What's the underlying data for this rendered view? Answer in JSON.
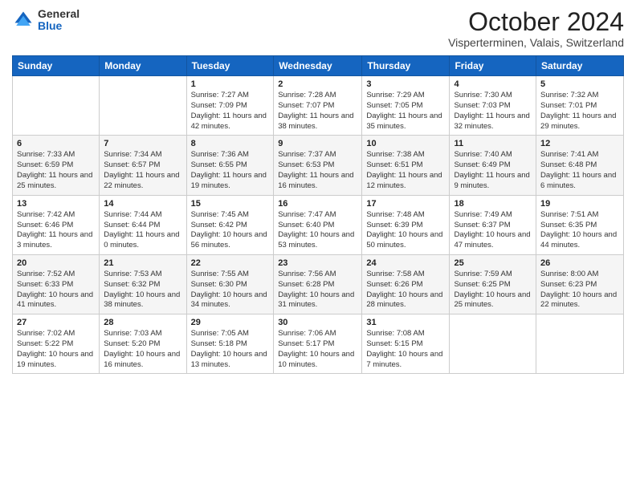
{
  "header": {
    "logo_general": "General",
    "logo_blue": "Blue",
    "month_title": "October 2024",
    "location": "Visperterminen, Valais, Switzerland"
  },
  "weekdays": [
    "Sunday",
    "Monday",
    "Tuesday",
    "Wednesday",
    "Thursday",
    "Friday",
    "Saturday"
  ],
  "weeks": [
    [
      {
        "day": "",
        "detail": ""
      },
      {
        "day": "",
        "detail": ""
      },
      {
        "day": "1",
        "detail": "Sunrise: 7:27 AM\nSunset: 7:09 PM\nDaylight: 11 hours and 42 minutes."
      },
      {
        "day": "2",
        "detail": "Sunrise: 7:28 AM\nSunset: 7:07 PM\nDaylight: 11 hours and 38 minutes."
      },
      {
        "day": "3",
        "detail": "Sunrise: 7:29 AM\nSunset: 7:05 PM\nDaylight: 11 hours and 35 minutes."
      },
      {
        "day": "4",
        "detail": "Sunrise: 7:30 AM\nSunset: 7:03 PM\nDaylight: 11 hours and 32 minutes."
      },
      {
        "day": "5",
        "detail": "Sunrise: 7:32 AM\nSunset: 7:01 PM\nDaylight: 11 hours and 29 minutes."
      }
    ],
    [
      {
        "day": "6",
        "detail": "Sunrise: 7:33 AM\nSunset: 6:59 PM\nDaylight: 11 hours and 25 minutes."
      },
      {
        "day": "7",
        "detail": "Sunrise: 7:34 AM\nSunset: 6:57 PM\nDaylight: 11 hours and 22 minutes."
      },
      {
        "day": "8",
        "detail": "Sunrise: 7:36 AM\nSunset: 6:55 PM\nDaylight: 11 hours and 19 minutes."
      },
      {
        "day": "9",
        "detail": "Sunrise: 7:37 AM\nSunset: 6:53 PM\nDaylight: 11 hours and 16 minutes."
      },
      {
        "day": "10",
        "detail": "Sunrise: 7:38 AM\nSunset: 6:51 PM\nDaylight: 11 hours and 12 minutes."
      },
      {
        "day": "11",
        "detail": "Sunrise: 7:40 AM\nSunset: 6:49 PM\nDaylight: 11 hours and 9 minutes."
      },
      {
        "day": "12",
        "detail": "Sunrise: 7:41 AM\nSunset: 6:48 PM\nDaylight: 11 hours and 6 minutes."
      }
    ],
    [
      {
        "day": "13",
        "detail": "Sunrise: 7:42 AM\nSunset: 6:46 PM\nDaylight: 11 hours and 3 minutes."
      },
      {
        "day": "14",
        "detail": "Sunrise: 7:44 AM\nSunset: 6:44 PM\nDaylight: 11 hours and 0 minutes."
      },
      {
        "day": "15",
        "detail": "Sunrise: 7:45 AM\nSunset: 6:42 PM\nDaylight: 10 hours and 56 minutes."
      },
      {
        "day": "16",
        "detail": "Sunrise: 7:47 AM\nSunset: 6:40 PM\nDaylight: 10 hours and 53 minutes."
      },
      {
        "day": "17",
        "detail": "Sunrise: 7:48 AM\nSunset: 6:39 PM\nDaylight: 10 hours and 50 minutes."
      },
      {
        "day": "18",
        "detail": "Sunrise: 7:49 AM\nSunset: 6:37 PM\nDaylight: 10 hours and 47 minutes."
      },
      {
        "day": "19",
        "detail": "Sunrise: 7:51 AM\nSunset: 6:35 PM\nDaylight: 10 hours and 44 minutes."
      }
    ],
    [
      {
        "day": "20",
        "detail": "Sunrise: 7:52 AM\nSunset: 6:33 PM\nDaylight: 10 hours and 41 minutes."
      },
      {
        "day": "21",
        "detail": "Sunrise: 7:53 AM\nSunset: 6:32 PM\nDaylight: 10 hours and 38 minutes."
      },
      {
        "day": "22",
        "detail": "Sunrise: 7:55 AM\nSunset: 6:30 PM\nDaylight: 10 hours and 34 minutes."
      },
      {
        "day": "23",
        "detail": "Sunrise: 7:56 AM\nSunset: 6:28 PM\nDaylight: 10 hours and 31 minutes."
      },
      {
        "day": "24",
        "detail": "Sunrise: 7:58 AM\nSunset: 6:26 PM\nDaylight: 10 hours and 28 minutes."
      },
      {
        "day": "25",
        "detail": "Sunrise: 7:59 AM\nSunset: 6:25 PM\nDaylight: 10 hours and 25 minutes."
      },
      {
        "day": "26",
        "detail": "Sunrise: 8:00 AM\nSunset: 6:23 PM\nDaylight: 10 hours and 22 minutes."
      }
    ],
    [
      {
        "day": "27",
        "detail": "Sunrise: 7:02 AM\nSunset: 5:22 PM\nDaylight: 10 hours and 19 minutes."
      },
      {
        "day": "28",
        "detail": "Sunrise: 7:03 AM\nSunset: 5:20 PM\nDaylight: 10 hours and 16 minutes."
      },
      {
        "day": "29",
        "detail": "Sunrise: 7:05 AM\nSunset: 5:18 PM\nDaylight: 10 hours and 13 minutes."
      },
      {
        "day": "30",
        "detail": "Sunrise: 7:06 AM\nSunset: 5:17 PM\nDaylight: 10 hours and 10 minutes."
      },
      {
        "day": "31",
        "detail": "Sunrise: 7:08 AM\nSunset: 5:15 PM\nDaylight: 10 hours and 7 minutes."
      },
      {
        "day": "",
        "detail": ""
      },
      {
        "day": "",
        "detail": ""
      }
    ]
  ]
}
